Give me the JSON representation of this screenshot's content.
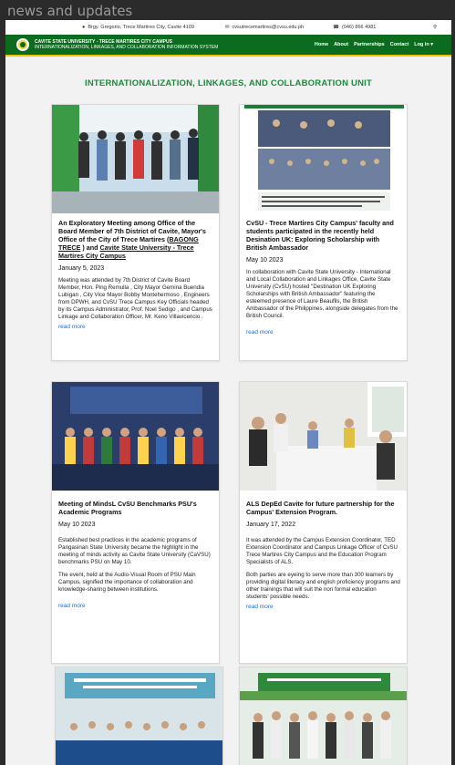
{
  "window": {
    "title": "news and updates"
  },
  "topbar": {
    "address": "Brgy. Gregorio, Trece Martires City, Cavite 4109",
    "email": "cvsutrecemartires@cvsu.edu.ph",
    "phone": "(046) 866 4981"
  },
  "nav": {
    "brand_line1": "CAVITE STATE UNIVERSITY - TRECE MARTIRES CITY CAMPUS",
    "brand_line2": "INTERNATIONALIZATION, LINKAGES, AND COLLABORATION INFORMATION SYSTEM",
    "items": [
      "Home",
      "About",
      "Partnerships",
      "Contact",
      "Log in"
    ],
    "accent": "#0b6b1e"
  },
  "main": {
    "heading": "INTERNATIONALIZATION, LINKAGES, AND COLLABORATION UNIT",
    "cards": [
      {
        "title_a": "An Exploratory Meeting among Office of the Board Member of 7th District of Cavite, Mayor's Office of the City of Trece Martires (",
        "title_b": "BAGONG TRECE",
        "title_c": ") and",
        "title_d": "Cavite State University - Trece Martires City Campus",
        "date": "January 5, 2023",
        "text": "Meeting was attended by 7th District of Cavite Board Member, Hon. Ping Remulla , City Mayor Gemina Buendia Lubigan , City Vice Mayor Bobby Montehermoso , Engineers from DPWH, and CvSU Trece Campus Key Officials headed by its Campus Administrator, Prof. Noel Sedigo , and Campus Linkage and Collaboration Officer, Mr. Keno Villavicencio .",
        "more": "read more"
      },
      {
        "title": "CvSU - Trece Martires City Campus' faculty and students participated in the recently held Desination UK: Exploring Scholarship with British Ambassador",
        "date": "May 10 2023",
        "text": "In collaboration with Cavite State University - International and Local Collaboration and Linkages Office, Cavite State University (CvSU) hosted \"Destination UK Exploring Scholarships with British Ambassador\" featuring the esteemed presence of Laure Beaufils, the British Ambassador of the Philippines, alongside delegates from the British Council.",
        "more": "read more"
      },
      {
        "title": "Meeting of MindsL CvSU Benchmarks PSU's Academic Programs",
        "date": "May 10 2023",
        "text": "Established best practices in the academic programs of Pangasinan State University became the highlight in the meeting of minds activity as Cavite State University (CaVSU) benchmarks PSU on May 10.",
        "text2": "The event, held at the Audio-Visual Room of PSU Main Campus, signified the importance of collaboration and knowledge-sharing between institutions.",
        "more": "read more"
      },
      {
        "title": "ALS DepEd Cavite for future partnership for the Campus' Extension Program.",
        "date": "January 17, 2022",
        "text": "It was attended by the Campus Extension Coordinator, TED Extension Coordinator and Campus Linkage Officer of CvSU Trece Martires City Campus and the Education Program Specialists of ALS.",
        "text2": "Both parties are eyeing to serve more than 300 learners by providing digital literacy and english proficiency programs and other trainings that will suit the non formal education students' possible needs.",
        "more": "read more"
      }
    ]
  }
}
